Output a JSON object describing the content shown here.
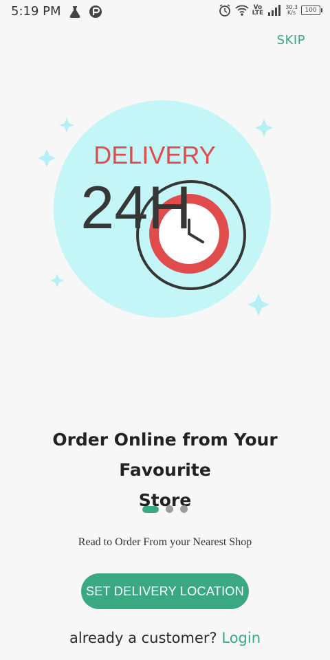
{
  "status_bar": {
    "time": "5:19 PM",
    "lte_top": "Vo",
    "lte_bottom": "LTE",
    "speed_value": "30.3",
    "speed_unit": "K/s",
    "battery": "100",
    "icons": [
      "flask-icon",
      "sync-icon",
      "alarm-icon",
      "wifi-icon",
      "signal-icon"
    ]
  },
  "header": {
    "skip_label": "SKIP"
  },
  "hero": {
    "title": "DELIVERY",
    "hours": "24H",
    "colors": {
      "circle": "#c4f6f8",
      "red": "#e04b4b",
      "dark": "#363636"
    }
  },
  "onboarding": {
    "headline_line1": "Order Online from Your Favourite",
    "headline_line2": "Store",
    "subtext": "Read to Order From your Nearest Shop",
    "page_index": 1,
    "page_count": 3
  },
  "cta": {
    "label": "SET DELIVERY LOCATION"
  },
  "login": {
    "prompt": "already a customer?",
    "link": "Login"
  },
  "colors": {
    "accent": "#3aa981",
    "background": "#f7f7f7"
  }
}
